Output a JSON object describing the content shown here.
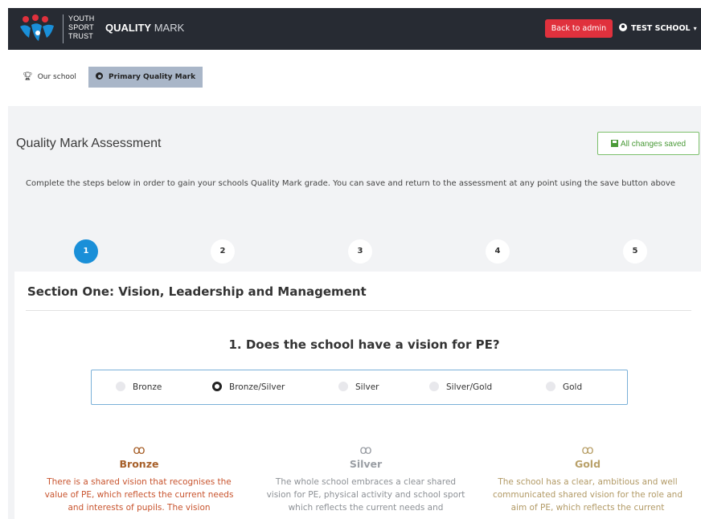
{
  "header": {
    "logo_lines": [
      "YOUTH",
      "SPORT",
      "TRUST"
    ],
    "title_strong": "QUALITY",
    "title_light": "MARK",
    "back_label": "Back to admin",
    "user_label": "TEST SCHOOL"
  },
  "breadcrumb": {
    "school_label": "Our school",
    "current_label": "Primary Quality Mark"
  },
  "assessment": {
    "title": "Quality Mark Assessment",
    "saved_label": "All changes saved",
    "intro": "Complete the steps below in order to gain your schools Quality Mark grade. You can save and return to the assessment at any point using the save button above"
  },
  "steps": [
    {
      "label": "1",
      "active": true
    },
    {
      "label": "2",
      "active": false
    },
    {
      "label": "3",
      "active": false
    },
    {
      "label": "4",
      "active": false
    },
    {
      "label": "5",
      "active": false
    }
  ],
  "section": {
    "title": "Section One: Vision, Leadership and Management",
    "question": "1. Does the school have a vision for PE?",
    "options": [
      {
        "label": "Bronze",
        "checked": false
      },
      {
        "label": "Bronze/Silver",
        "checked": true
      },
      {
        "label": "Silver",
        "checked": false
      },
      {
        "label": "Silver/Gold",
        "checked": false
      },
      {
        "label": "Gold",
        "checked": false
      }
    ],
    "levels": [
      {
        "name": "Bronze",
        "desc": "There is a shared vision that recognises the value of PE, which reflects the current needs and interests of pupils. The vision"
      },
      {
        "name": "Silver",
        "desc": "The whole school embraces a clear shared vision for PE, physical activity and school sport which reflects the current needs and"
      },
      {
        "name": "Gold",
        "desc": "The school has a clear, ambitious and well communicated shared vision for the role and aim of PE, which reflects the current"
      }
    ]
  },
  "colors": {
    "nav_bg": "#272b33",
    "back_button": "#e0313d",
    "step_active": "#1a8fd8",
    "saved_green": "#4a9a38",
    "bronze": "#a7602a",
    "silver": "#9a9ea4",
    "gold": "#b9a16a"
  },
  "icons": {
    "user": "user-circle-icon",
    "school": "trophy-icon",
    "current": "dot-circle-icon",
    "saved": "floppy-disk-icon",
    "medal": "medal-icon"
  }
}
